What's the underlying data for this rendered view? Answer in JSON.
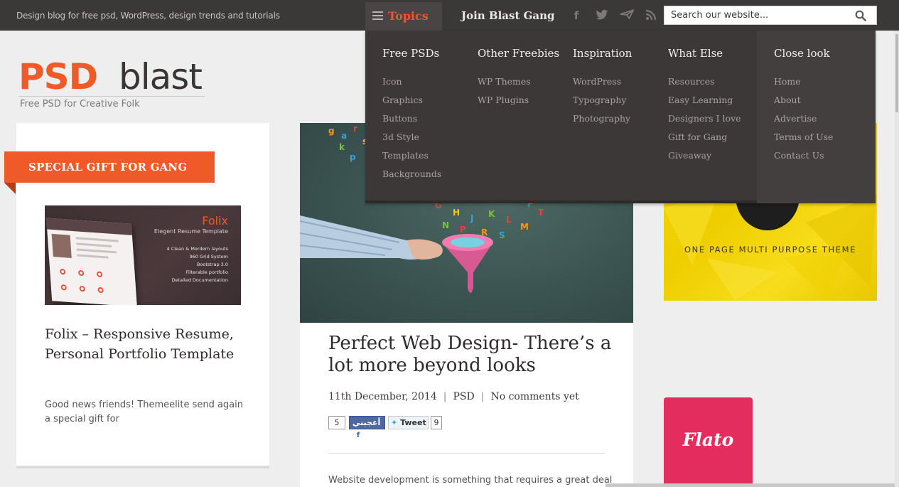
{
  "topbar": {
    "tagline": "Design blog for free psd, WordPress, design trends and tutorials",
    "topics_label": "Topics",
    "join_label": "Join Blast Gang",
    "social_icons": [
      "facebook-icon",
      "twitter-icon",
      "paper-plane-icon",
      "rss-icon"
    ],
    "search_placeholder": "Search our website..."
  },
  "logo": {
    "psd": "PSD",
    "blast": "blast",
    "subtitle": "Free PSD for Creative Folk"
  },
  "left_card": {
    "ribbon": "SPECIAL GIFT FOR GANG",
    "image_title": "Folix",
    "image_subtitle": "Elegent Resume Template",
    "image_features": [
      "4 Clean & Mordern layouts",
      "960 Grid System",
      "Bootstrap 3.0",
      "Filterable portfolio",
      "Detailed Documentation"
    ],
    "title": "Folix – Responsive Resume, Personal Portfolio Template",
    "excerpt": "Good news friends! Themeelite send again a special gift for"
  },
  "post": {
    "title": "Perfect Web Design- There’s a lot more beyond looks",
    "date": "11th December, 2014",
    "category": "PSD",
    "comments": "No comments yet",
    "fb_count": "5",
    "fb_label": "أعجبني",
    "tweet_label": "Tweet",
    "tweet_count": "9",
    "excerpt": "Website development is something that requires a great deal"
  },
  "right": {
    "yellow_tagline": "ONE PAGE MULTI PURPOSE THEME",
    "flato": "Flato"
  },
  "menu": {
    "columns": [
      {
        "heading": "Free PSDs",
        "items": [
          "Icon",
          "Graphics",
          "Buttons",
          "3d Style",
          "Templates",
          "Backgrounds"
        ]
      },
      {
        "heading": "Other Freebies",
        "items": [
          "WP Themes",
          "WP Plugins"
        ]
      },
      {
        "heading": "Inspiration",
        "items": [
          "WordPress",
          "Typography",
          "Photography"
        ]
      },
      {
        "heading": "What Else",
        "items": [
          "Resources",
          "Easy Learning",
          "Designers I love",
          "Gift for Gang",
          "Giveaway"
        ]
      },
      {
        "heading": "Close look",
        "items": [
          "Home",
          "About",
          "Advertise",
          "Terms of Use",
          "Contact Us"
        ]
      }
    ]
  },
  "colors": {
    "accent": "#f05a28",
    "topbar": "#3b3838",
    "menu_bg": "#3c3838",
    "yellow": "#f3d400",
    "flato_pink": "#e32d5f"
  }
}
